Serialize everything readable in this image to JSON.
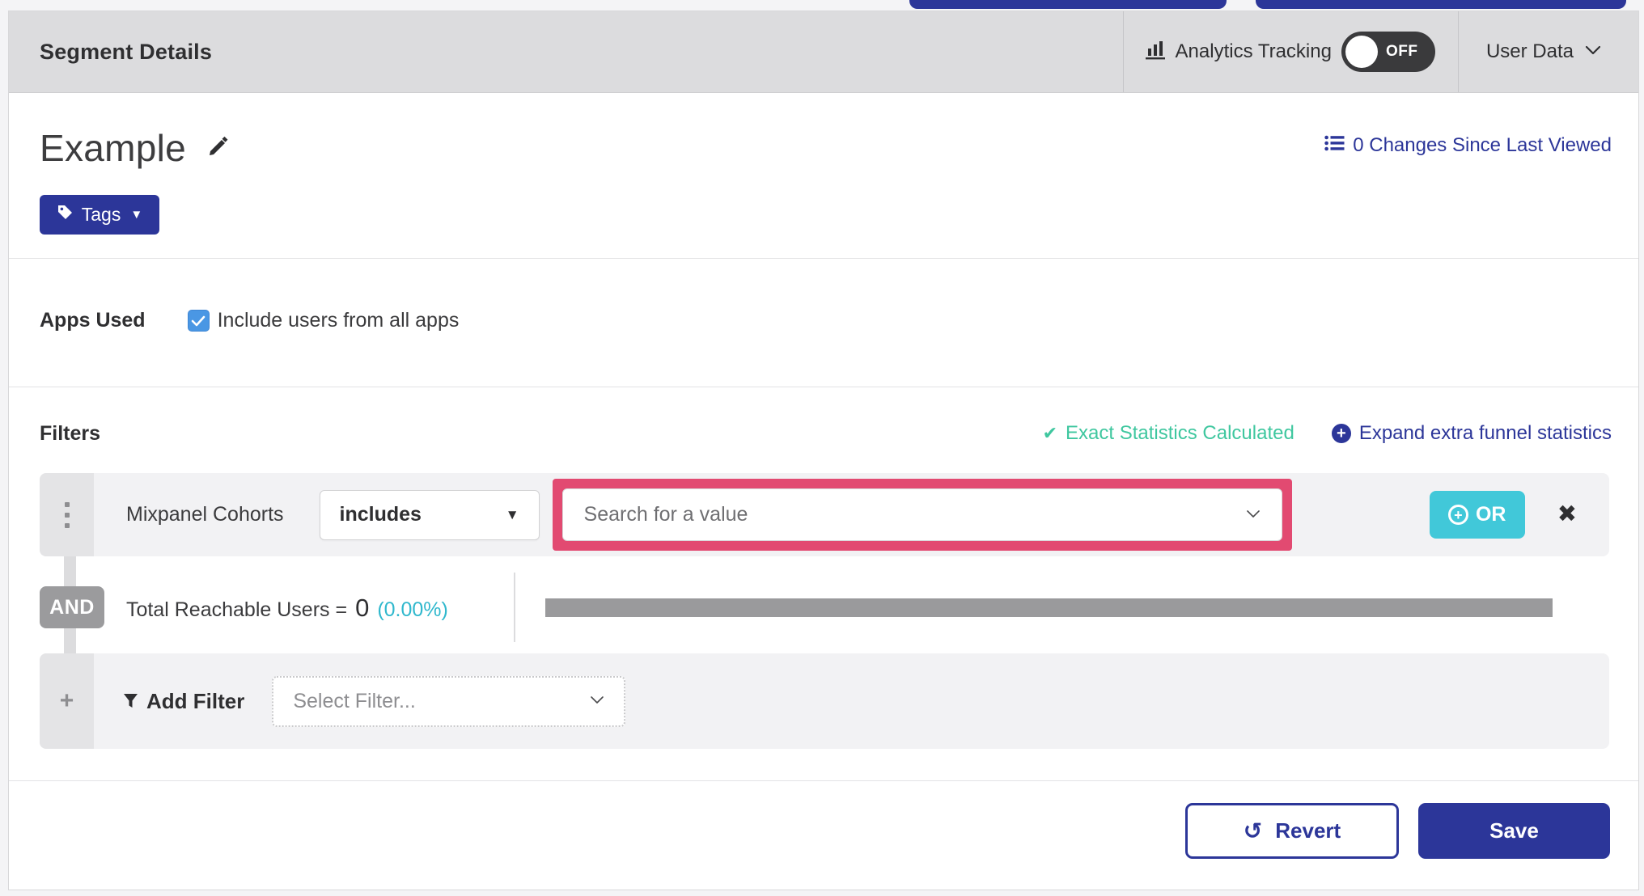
{
  "header": {
    "title": "Segment Details",
    "analytics_label": "Analytics Tracking",
    "toggle_state": "OFF",
    "user_data": "User Data"
  },
  "segment": {
    "name": "Example",
    "changes_summary": "0 Changes Since Last Viewed",
    "tags_button": "Tags"
  },
  "apps_used": {
    "label": "Apps Used",
    "include_all_label": "Include users from all apps",
    "checked": true
  },
  "filters": {
    "title": "Filters",
    "exact_statistics": "Exact Statistics Calculated",
    "expand_funnel": "Expand extra funnel statistics",
    "filter_row": {
      "field": "Mixpanel Cohorts",
      "operator": "includes",
      "value_placeholder": "Search for a value",
      "or_button": "OR"
    },
    "and_badge": "AND",
    "total_reachable": {
      "label": "Total Reachable Users =",
      "value": "0",
      "percent": "(0.00%)"
    },
    "add_filter": {
      "label": "Add Filter",
      "placeholder": "Select Filter..."
    }
  },
  "footer": {
    "revert": "Revert",
    "save": "Save"
  },
  "colors": {
    "indigo_primary": "#2c3699",
    "or_teal": "#41c8d9",
    "exact_stats_green": "#3fc79f",
    "percent_cyan": "#30b8cd",
    "highlight_pink": "#e24a71",
    "toggle_off_bg": "#3a3a3c",
    "checkbox_blue": "#4a97e4"
  }
}
